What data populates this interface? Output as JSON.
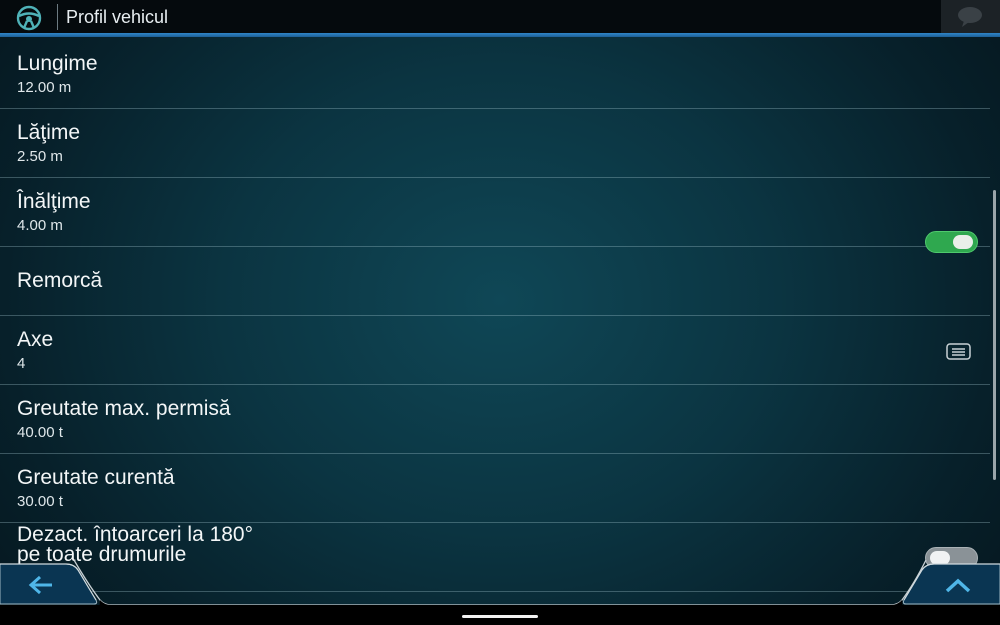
{
  "header": {
    "title": "Profil vehicul",
    "icon": "steering-wheel-icon",
    "message_icon": "speech-bubble-icon"
  },
  "rows": [
    {
      "title": "Lungime",
      "value": "12.00 m"
    },
    {
      "title": "Lăţime",
      "value": "2.50 m"
    },
    {
      "title": "Înălţime",
      "value": "4.00 m"
    },
    {
      "title": "Remorcă",
      "toggle": "on"
    },
    {
      "title": "Axe",
      "value": "4",
      "icon": "list-icon"
    },
    {
      "title": "Greutate max. permisă",
      "value": "40.00 t"
    },
    {
      "title": "Greutate curentă",
      "value": "30.00 t"
    },
    {
      "title": "Dezact. întoarceri la 180°",
      "value": "pe toate drumurile",
      "toggle": "off"
    }
  ],
  "footer": {
    "back_icon": "arrow-left-icon",
    "up_icon": "chevron-up-icon"
  },
  "colors": {
    "accent": "#2f86c9",
    "toggle_on": "#2fa84f",
    "background": "#0b3441"
  }
}
